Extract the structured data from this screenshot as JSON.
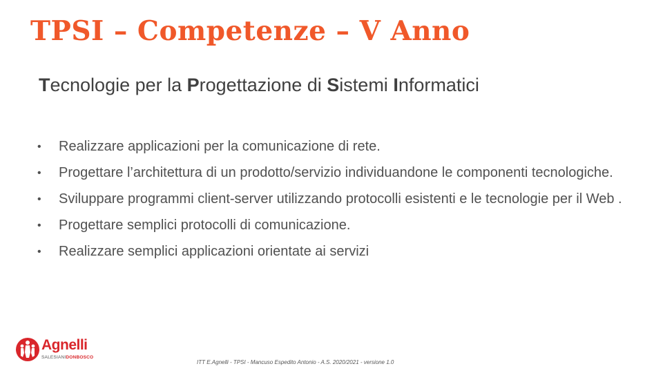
{
  "title": "TPSI – Competenze – V Anno",
  "subtitle": {
    "parts": [
      {
        "initial": "T",
        "rest": "ecnologie per la "
      },
      {
        "initial": "P",
        "rest": "rogettazione di "
      },
      {
        "initial": "S",
        "rest": "istemi "
      },
      {
        "initial": "I",
        "rest": "nformatici"
      }
    ]
  },
  "bullet_symbol": "•",
  "bullets": [
    "Realizzare applicazioni per la comunicazione di rete.",
    "Progettare l’architettura di un prodotto/servizio individuandone le componenti tecnologiche.",
    "Sviluppare programmi client-server utilizzando protocolli esistenti e le tecnologie per il Web .",
    "Progettare semplici protocolli di comunicazione.",
    "Realizzare semplici applicazioni orientate ai servizi"
  ],
  "logo": {
    "name": "Agnelli",
    "sub_prefix": "SALESIANI",
    "sub_highlight": "DONBOSCO",
    "colors": {
      "brand": "#d9262b"
    },
    "icon": "salesiani-people-icon"
  },
  "footer": "ITT E.Agnelli - TPSI - Mancuso Espedito Antonio - A.S. 2020/2021 - versione 1.0",
  "colors": {
    "title": "#f0582a",
    "text": "#505050"
  }
}
